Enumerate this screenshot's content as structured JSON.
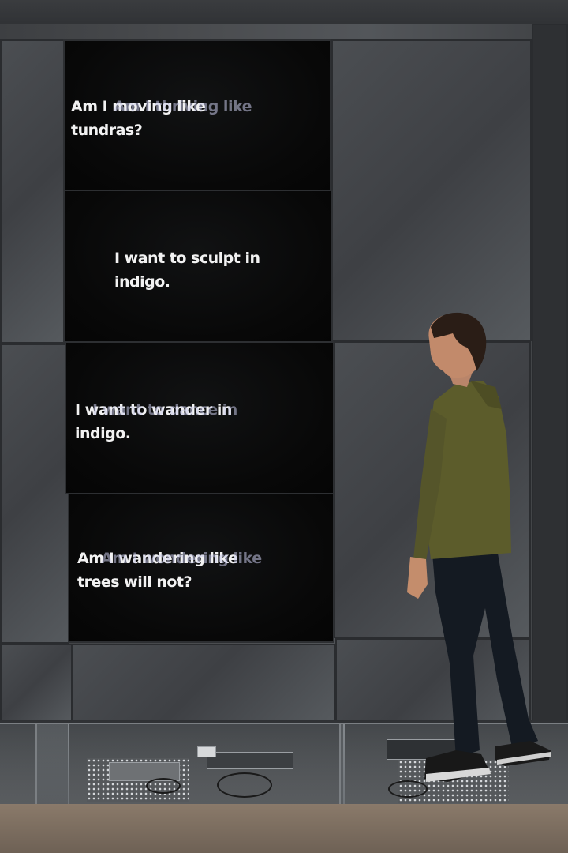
{
  "screens": [
    {
      "lines": [
        "Am I moving like",
        "tundras?"
      ],
      "ghost": "Am I thriving like"
    },
    {
      "lines": [
        "I want to sculpt in",
        "indigo."
      ]
    },
    {
      "lines": [
        "I want to wander in",
        "indigo."
      ],
      "ghost": "I want to dance in"
    },
    {
      "lines": [
        "Am I wandering like",
        "trees will not?"
      ],
      "ghost": "Am I wondering like"
    }
  ]
}
